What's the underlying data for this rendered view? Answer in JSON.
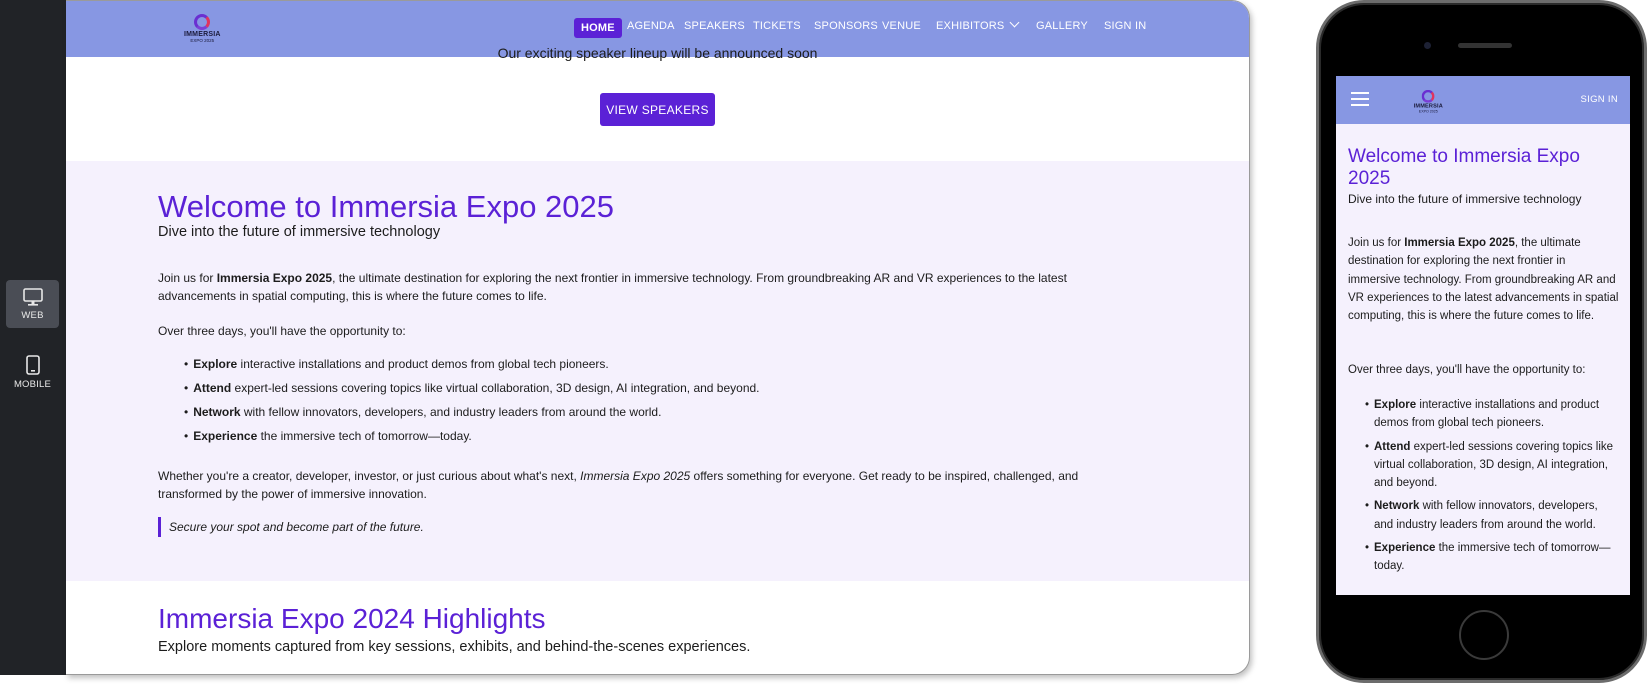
{
  "side": {
    "web_label": "WEB",
    "mobile_label": "MOBILE"
  },
  "nav": {
    "logo_name": "IMMERSIA",
    "logo_sub": "EXPO 2025",
    "items": [
      "HOME",
      "AGENDA",
      "SPEAKERS",
      "TICKETS",
      "SPONSORS",
      "VENUE",
      "EXHIBITORS",
      "GALLERY",
      "SIGN IN"
    ]
  },
  "speakers": {
    "lineup_text": "Our exciting speaker lineup will be announced soon",
    "button_label": "VIEW SPEAKERS"
  },
  "welcome": {
    "title": "Welcome to Immersia Expo 2025",
    "subtitle": "Dive into the future of immersive technology",
    "p1_pre": "Join us for ",
    "p1_bold": "Immersia Expo 2025",
    "p1_post": ", the ultimate destination for exploring the next frontier in immersive technology. From groundbreaking AR and VR experiences to the latest advancements in spatial computing, this is where the future comes to life.",
    "p2": "Over three days, you'll have the opportunity to:",
    "list": [
      {
        "bold": "Explore",
        "text": " interactive installations and product demos from global tech pioneers."
      },
      {
        "bold": "Attend",
        "text": " expert-led sessions covering topics like virtual collaboration, 3D design, AI integration, and beyond."
      },
      {
        "bold": "Network",
        "text": " with fellow innovators, developers, and industry leaders from around the world."
      },
      {
        "bold": "Experience",
        "text": " the immersive tech of tomorrow—today."
      }
    ],
    "p3_pre": "Whether you're a creator, developer, investor, or just curious about what's next, ",
    "p3_italic": "Immersia Expo 2025",
    "p3_post": " offers something for everyone. Get ready to be inspired, challenged, and transformed by the power of immersive innovation.",
    "quote": "Secure your spot and become part of the future."
  },
  "highlights": {
    "title": "Immersia Expo 2024 Highlights",
    "subtitle": "Explore moments captured from key sessions, exhibits, and behind-the-scenes experiences."
  },
  "mobile": {
    "signin": "SIGN IN"
  }
}
